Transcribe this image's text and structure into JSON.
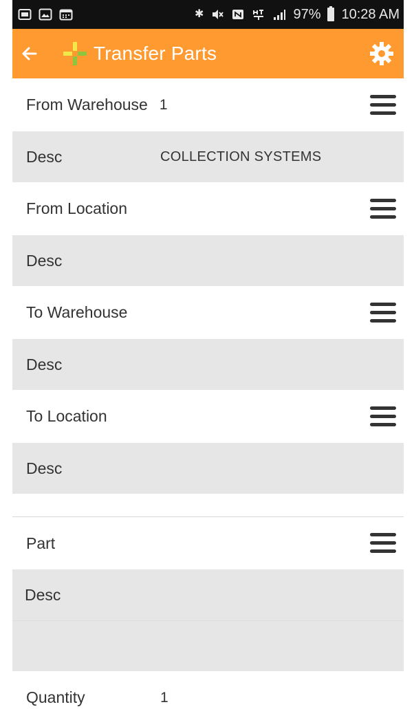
{
  "status_bar": {
    "left_icons": [
      "mail-icon",
      "image-icon",
      "calendar-icon"
    ],
    "right_icons": [
      "bluetooth-icon",
      "mute-icon",
      "nfc-icon",
      "lte-icon",
      "signal-icon"
    ],
    "battery_percent": "97%",
    "time": "10:28 AM"
  },
  "app_bar": {
    "title": "Transfer Parts",
    "background": "#ff9a30"
  },
  "form": {
    "from_warehouse": {
      "label": "From Warehouse",
      "value": "1"
    },
    "from_warehouse_desc": {
      "label": "Desc",
      "value": "COLLECTION SYSTEMS"
    },
    "from_location": {
      "label": "From Location",
      "value": ""
    },
    "from_location_desc": {
      "label": "Desc",
      "value": ""
    },
    "to_warehouse": {
      "label": "To Warehouse",
      "value": ""
    },
    "to_warehouse_desc": {
      "label": "Desc",
      "value": ""
    },
    "to_location": {
      "label": "To Location",
      "value": ""
    },
    "to_location_desc": {
      "label": "Desc",
      "value": ""
    },
    "part": {
      "label": "Part",
      "value": ""
    },
    "part_desc": {
      "label": "Desc",
      "value": ""
    },
    "quantity": {
      "label": "Quantity",
      "value": "1"
    }
  }
}
